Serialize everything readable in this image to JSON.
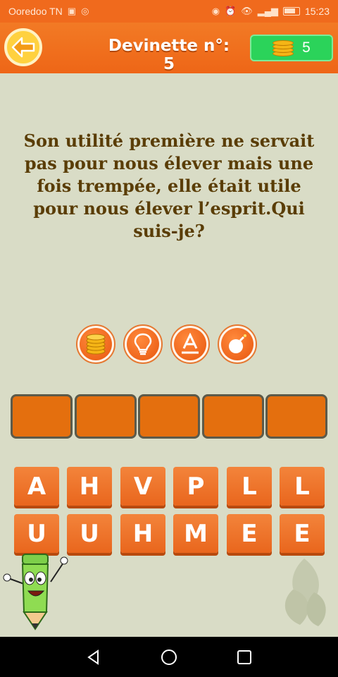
{
  "status_bar": {
    "carrier": "Ooredoo TN",
    "time": "15:23",
    "signal_strength": "medium"
  },
  "header": {
    "title": "Devinette n°: 5",
    "coins": "5"
  },
  "question": "Son utilité première ne servait pas pour nous élever mais une fois trempée, elle était utile pour nous élever l’esprit.Qui suis-je?",
  "help_buttons": [
    {
      "name": "coins-help-icon"
    },
    {
      "name": "lightbulb-hint-icon"
    },
    {
      "name": "reveal-letter-icon"
    },
    {
      "name": "bomb-remove-icon"
    }
  ],
  "answer_slots": [
    "",
    "",
    "",
    "",
    ""
  ],
  "letter_rows": [
    [
      "A",
      "H",
      "V",
      "P",
      "L",
      "L"
    ],
    [
      "U",
      "U",
      "H",
      "M",
      "E",
      "E"
    ]
  ],
  "colors": {
    "primary_orange": "#f06a1d",
    "coin_box_green": "#2bd35a",
    "background": "#d9dcc6",
    "question_text": "#5a3d06"
  }
}
